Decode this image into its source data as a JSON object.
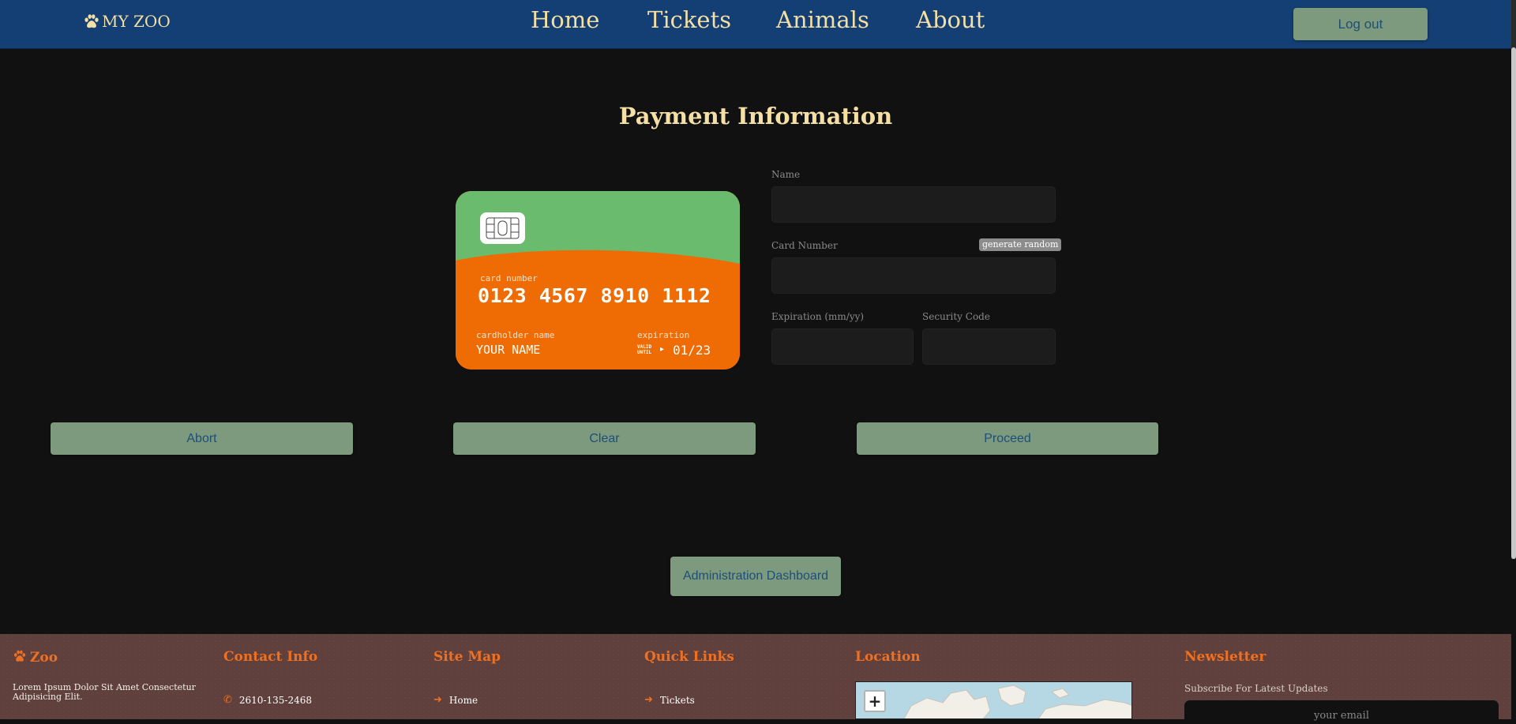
{
  "nav": {
    "brand": "MY ZOO",
    "links": [
      "Home",
      "Tickets",
      "Animals",
      "About"
    ],
    "logout": "Log out"
  },
  "page": {
    "title": "Payment Information"
  },
  "card": {
    "number_label": "card number",
    "number": "0123 4567 8910 1112",
    "holder_label": "cardholder name",
    "holder_name": "YOUR NAME",
    "expiration_label": "expiration",
    "valid_until": "VALID\nUNTIL",
    "expiration": "01/23",
    "colors": {
      "top": "#6abb6e",
      "bottom": "#ee6c03"
    }
  },
  "form": {
    "name_label": "Name",
    "card_number_label": "Card Number",
    "generate_random": "generate random",
    "expiration_label": "Expiration (mm/yy)",
    "security_code_label": "Security Code"
  },
  "actions": {
    "abort": "Abort",
    "clear": "Clear",
    "proceed": "Proceed",
    "admin_dashboard": "Administration Dashboard"
  },
  "footer": {
    "brand": "Zoo",
    "about": "Lorem Ipsum Dolor Sit Amet Consectetur Adipisicing Elit.",
    "contact_heading": "Contact Info",
    "phone": "2610-135-2468",
    "sitemap_heading": "Site Map",
    "sitemap_first": "Home",
    "quicklinks_heading": "Quick Links",
    "quicklinks_first": "Tickets",
    "location_heading": "Location",
    "map_zoom_in": "+",
    "newsletter_heading": "Newsletter",
    "newsletter_sub": "Subscribe For Latest Updates",
    "newsletter_placeholder": "your email"
  },
  "colors": {
    "nav_bg": "#133f74",
    "accent_text": "#f4dfa4",
    "button_bg": "#7d9a7f",
    "button_text": "#1d4f77",
    "footer_bg": "#5f403d",
    "footer_accent": "#f07021"
  }
}
